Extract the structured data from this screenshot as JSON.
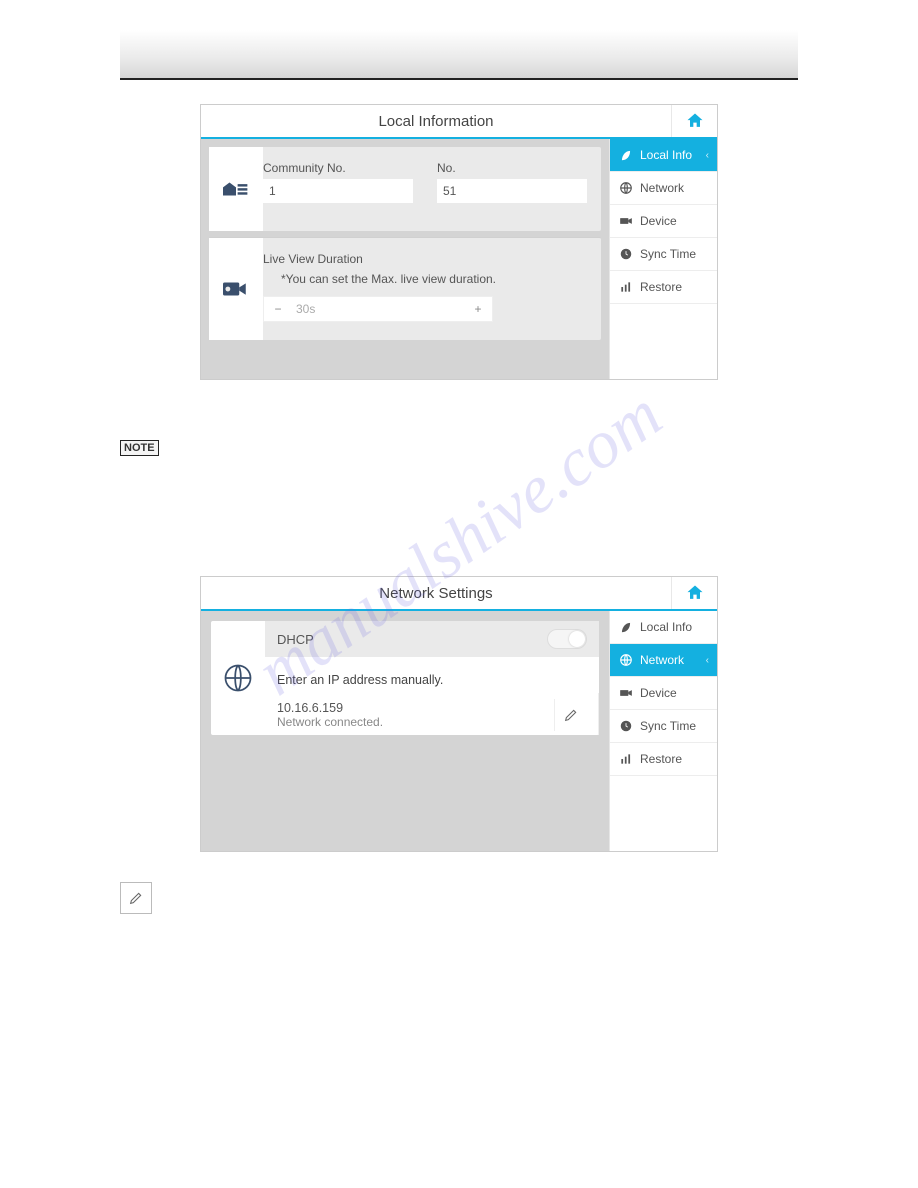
{
  "watermark": "manualshive.com",
  "note_badge": "NOTE",
  "panel1": {
    "title": "Local Information",
    "sidebar": [
      {
        "label": "Local Info",
        "icon": "leaf",
        "active": true
      },
      {
        "label": "Network",
        "icon": "globe"
      },
      {
        "label": "Device",
        "icon": "camera"
      },
      {
        "label": "Sync Time",
        "icon": "clock"
      },
      {
        "label": "Restore",
        "icon": "bars"
      }
    ],
    "community_label": "Community No.",
    "community_value": "1",
    "no_label": "No.",
    "no_value": "51",
    "lv_title": "Live View Duration",
    "lv_note": "*You can set the Max. live view duration.",
    "lv_value": "30s"
  },
  "panel2": {
    "title": "Network Settings",
    "sidebar": [
      {
        "label": "Local Info",
        "icon": "leaf"
      },
      {
        "label": "Network",
        "icon": "globe",
        "active": true
      },
      {
        "label": "Device",
        "icon": "camera"
      },
      {
        "label": "Sync Time",
        "icon": "clock"
      },
      {
        "label": "Restore",
        "icon": "bars"
      }
    ],
    "dhcp_label": "DHCP",
    "manual_text": "Enter an IP address manually.",
    "ip": "10.16.6.159",
    "ip_status": "Network connected."
  }
}
